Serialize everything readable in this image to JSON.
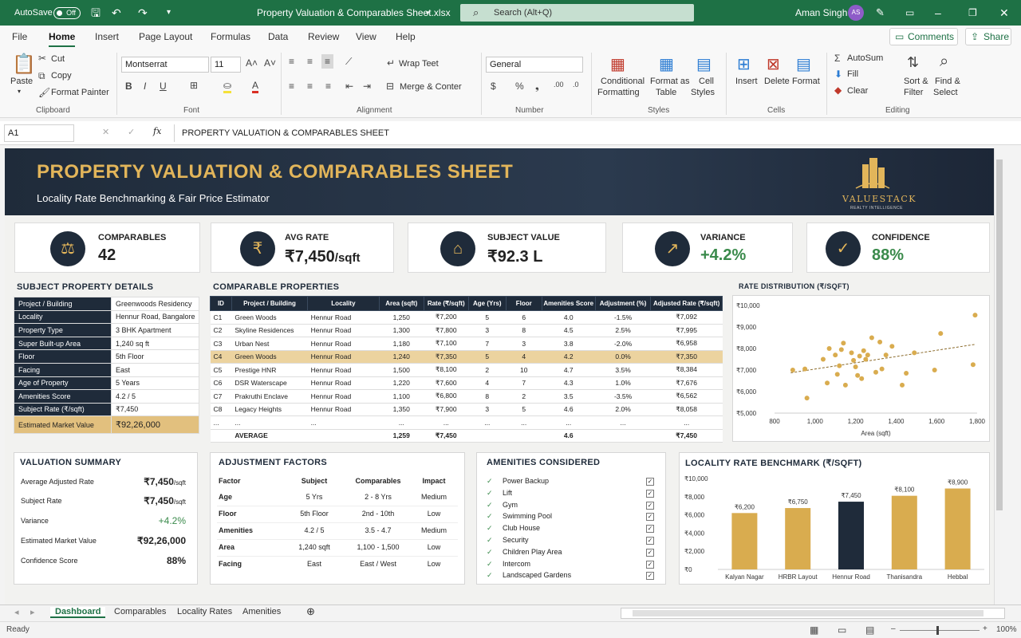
{
  "titlebar": {
    "autosave": "AutoSave",
    "toggle": "Off",
    "filename": "Property Valuation & Comparables Sheet.xlsx",
    "search": "Search (Alt+Q)",
    "user": "Aman Singh",
    "initials": "AS"
  },
  "menu": {
    "items": [
      "File",
      "Home",
      "Insert",
      "Page Layout",
      "Formulas",
      "Data",
      "Review",
      "View",
      "Help"
    ],
    "comments": "Comments",
    "share": "Share"
  },
  "ribbon": {
    "paste": "Paste",
    "cut": "Cut",
    "copy": "Copy",
    "format_painter": "Format Painter",
    "clipboard": "Clipboard",
    "font_name": "Montserrat",
    "font_size": "11",
    "font": "Font",
    "wrap_text": "Wrap Teet",
    "merge_center": "Merge & Conter",
    "alignment": "Alignment",
    "number_format": "General",
    "number": "Number",
    "cond_fmt": "Conditional",
    "cond_fmt2": "Formatting",
    "format_as": "Format as",
    "format_as2": "Table",
    "cell_styles": "Cell",
    "cell_styles2": "Styles",
    "styles": "Styles",
    "insert": "Insert",
    "delete": "Delete",
    "format": "Format",
    "cells": "Cells",
    "autosum": "AutoSum",
    "fill": "Fill",
    "clear": "Clear",
    "sort": "Sort &",
    "sort2": "Filter",
    "find": "Find &",
    "find2": "Select",
    "editing": "Editing"
  },
  "formula_bar": {
    "cell_ref": "A1",
    "fx": "fx",
    "content": "PROPERTY VALUATION & COMPARABLES SHEET"
  },
  "banner": {
    "title": "PROPERTY VALUATION & COMPARABLES SHEET",
    "subtitle": "Locality Rate Benchmarking & Fair Price Estimator",
    "logo": "VALUESTACK",
    "logo_sub": "REALTY INTELLIGENCE"
  },
  "kpis": [
    {
      "label": "COMPARABLES",
      "value": "42",
      "icon": "scales-icon"
    },
    {
      "label": "AVG RATE",
      "value": "₹7,450",
      "unit": "/sqft",
      "icon": "rupee-icon"
    },
    {
      "label": "SUBJECT VALUE",
      "value": "₹92.3 L",
      "icon": "house-icon"
    },
    {
      "label": "VARIANCE",
      "value": "+4.2%",
      "icon": "trend-up-icon"
    },
    {
      "label": "CONFIDENCE",
      "value": "88%",
      "icon": "shield-check-icon"
    }
  ],
  "subject": {
    "title": "SUBJECT PROPERTY DETAILS",
    "rows": [
      [
        "Project / Building",
        "Greenwoods Residency"
      ],
      [
        "Locality",
        "Hennur Road, Bangalore"
      ],
      [
        "Property Type",
        "3 BHK Apartment"
      ],
      [
        "Super Built-up Area",
        "1,240 sq ft"
      ],
      [
        "Floor",
        "5th Floor"
      ],
      [
        "Facing",
        "East"
      ],
      [
        "Age of Property",
        "5 Years"
      ],
      [
        "Amenities Score",
        "4.2 / 5"
      ],
      [
        "Subject Rate (₹/sqft)",
        "₹7,450"
      ]
    ],
    "total_label": "Estimated Market Value",
    "total_value": "₹92,26,000"
  },
  "comparables": {
    "title": "COMPARABLE PROPERTIES",
    "headers": [
      "ID",
      "Project / Building",
      "Locality",
      "Area (sqft)",
      "Rate (₹/sqft)",
      "Age (Yrs)",
      "Floor",
      "Amenities Score",
      "Adjustment (%)",
      "Adjusted Rate (₹/sqft)"
    ],
    "rows": [
      [
        "C1",
        "Green Woods",
        "Hennur Road",
        "1,250",
        "₹7,200",
        "5",
        "6",
        "4.0",
        "-1.5%",
        "₹7,092"
      ],
      [
        "C2",
        "Skyline Residences",
        "Hennur Road",
        "1,300",
        "₹7,800",
        "3",
        "8",
        "4.5",
        "2.5%",
        "₹7,995"
      ],
      [
        "C3",
        "Urban Nest",
        "Hennur Road",
        "1,180",
        "₹7,100",
        "7",
        "3",
        "3.8",
        "-2.0%",
        "₹6,958"
      ],
      [
        "C4",
        "Green Woods",
        "Hennur Road",
        "1,240",
        "₹7,350",
        "5",
        "4",
        "4.2",
        "0.0%",
        "₹7,350"
      ],
      [
        "C5",
        "Prestige HNR",
        "Hennur Road",
        "1,500",
        "₹8,100",
        "2",
        "10",
        "4.7",
        "3.5%",
        "₹8,384"
      ],
      [
        "C6",
        "DSR Waterscape",
        "Hennur Road",
        "1,220",
        "₹7,600",
        "4",
        "7",
        "4.3",
        "1.0%",
        "₹7,676"
      ],
      [
        "C7",
        "Prakruthi Enclave",
        "Hennur Road",
        "1,100",
        "₹6,800",
        "8",
        "2",
        "3.5",
        "-3.5%",
        "₹6,562"
      ],
      [
        "C8",
        "Legacy Heights",
        "Hennur Road",
        "1,350",
        "₹7,900",
        "3",
        "5",
        "4.6",
        "2.0%",
        "₹8,058"
      ],
      [
        "...",
        "...",
        "...",
        "...",
        "...",
        "...",
        "...",
        "...",
        "...",
        "..."
      ]
    ],
    "avg": [
      "",
      "AVERAGE",
      "",
      "1,259",
      "₹7,450",
      "",
      "",
      "4.6",
      "",
      "₹7,450"
    ]
  },
  "scatter": {
    "title": "RATE DISTRIBUTION (₹/SQFT)",
    "xlabel": "Area (sqft)",
    "yticks": [
      "₹10,000",
      "₹9,000",
      "₹8,000",
      "₹7,000",
      "₹6,000",
      "₹5,000"
    ],
    "xticks": [
      "800",
      "1,000",
      "1,200",
      "1,400",
      "1,600",
      "1,800"
    ]
  },
  "valuation": {
    "title": "VALUATION SUMMARY",
    "rows": [
      [
        "Average Adjusted Rate",
        "₹7,450",
        "/sqft"
      ],
      [
        "Subject Rate",
        "₹7,450",
        "/sqft"
      ],
      [
        "Variance",
        "+4.2%",
        ""
      ],
      [
        "Estimated Market Value",
        "₹92,26,000",
        ""
      ],
      [
        "Confidence Score",
        "88%",
        ""
      ]
    ]
  },
  "adjustments": {
    "title": "ADJUSTMENT FACTORS",
    "headers": [
      "Factor",
      "Subject",
      "Comparables",
      "Impact"
    ],
    "rows": [
      [
        "Age",
        "5 Yrs",
        "2 - 8 Yrs",
        "Medium"
      ],
      [
        "Floor",
        "5th Floor",
        "2nd - 10th",
        "Low"
      ],
      [
        "Amenities",
        "4.2 / 5",
        "3.5 - 4.7",
        "Medium"
      ],
      [
        "Area",
        "1,240 sqft",
        "1,100 - 1,500",
        "Low"
      ],
      [
        "Facing",
        "East",
        "East / West",
        "Low"
      ]
    ]
  },
  "amenities": {
    "title": "AMENITIES CONSIDERED",
    "items": [
      "Power Backup",
      "Lift",
      "Gym",
      "Swimming Pool",
      "Club House",
      "Security",
      "Children Play Area",
      "Intercom",
      "Landscaped Gardens"
    ]
  },
  "locality": {
    "title": "LOCALITY RATE BENCHMARK (₹/SQFT)",
    "yticks": [
      "₹10,000",
      "₹8,000",
      "₹6,000",
      "₹4,000",
      "₹2,000",
      "₹0"
    ]
  },
  "chart_data": [
    {
      "type": "scatter",
      "title": "RATE DISTRIBUTION (₹/SQFT)",
      "xlabel": "Area (sqft)",
      "ylabel": "",
      "xlim": [
        800,
        1800
      ],
      "ylim": [
        5000,
        10000
      ],
      "trendline": true,
      "points": [
        [
          890,
          7000
        ],
        [
          950,
          7050
        ],
        [
          960,
          5700
        ],
        [
          1040,
          7500
        ],
        [
          1060,
          6400
        ],
        [
          1070,
          8000
        ],
        [
          1100,
          7700
        ],
        [
          1110,
          6800
        ],
        [
          1120,
          7200
        ],
        [
          1130,
          7950
        ],
        [
          1140,
          8250
        ],
        [
          1150,
          6300
        ],
        [
          1180,
          7800
        ],
        [
          1190,
          7450
        ],
        [
          1200,
          7150
        ],
        [
          1210,
          6750
        ],
        [
          1220,
          7650
        ],
        [
          1230,
          6600
        ],
        [
          1240,
          7900
        ],
        [
          1250,
          7500
        ],
        [
          1260,
          7700
        ],
        [
          1280,
          8500
        ],
        [
          1300,
          6900
        ],
        [
          1320,
          8300
        ],
        [
          1330,
          7050
        ],
        [
          1350,
          7700
        ],
        [
          1380,
          8100
        ],
        [
          1430,
          6300
        ],
        [
          1450,
          6850
        ],
        [
          1490,
          7800
        ],
        [
          1590,
          7000
        ],
        [
          1620,
          8700
        ],
        [
          1780,
          7250
        ],
        [
          1790,
          9550
        ]
      ]
    },
    {
      "type": "bar",
      "title": "LOCALITY RATE BENCHMARK (₹/SQFT)",
      "categories": [
        "Kalyan Nagar",
        "HRBR Layout",
        "Hennur Road",
        "Thanisandra",
        "Hebbal"
      ],
      "values": [
        6200,
        6750,
        7450,
        8100,
        8900
      ],
      "labels": [
        "₹6,200",
        "₹6,750",
        "₹7,450",
        "₹8,100",
        "₹8,900"
      ],
      "ylim": [
        0,
        10000
      ],
      "colors": [
        "#d9ac4f",
        "#d9ac4f",
        "#1f2b3a",
        "#d9ac4f",
        "#d9ac4f"
      ]
    }
  ],
  "sheet_tabs": {
    "items": [
      "Dashboard",
      "Comparables",
      "Locality Rates",
      "Amenities"
    ]
  },
  "status": {
    "ready": "Ready",
    "zoom": "100%"
  }
}
